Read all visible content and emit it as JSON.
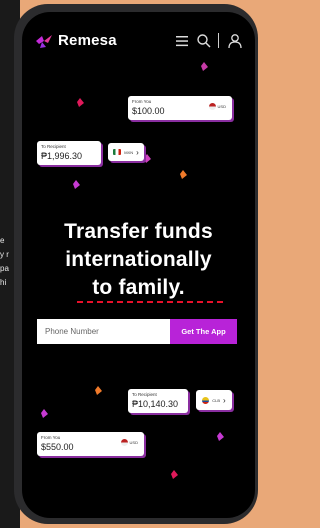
{
  "background_text": [
    "e",
    "y r",
    "pa",
    "hi"
  ],
  "brand": {
    "name": "Remesa",
    "accent": "#b823d8",
    "shadow": "#8a2ea0",
    "underline": "#e8102a"
  },
  "nav": {
    "icons": [
      "menu-icon",
      "search-icon",
      "user-icon"
    ]
  },
  "cards": {
    "top_from": {
      "label": "From You",
      "amount": "$100.00",
      "currency": "USD"
    },
    "top_to": {
      "label": "To Recipient",
      "amount": "₱1,996.30",
      "currency": "MXN"
    },
    "bottom_to": {
      "label": "To Recipient",
      "amount": "₱10,140.30",
      "currency": "CLB"
    },
    "bottom_from": {
      "label": "From You",
      "amount": "$550.00",
      "currency": "USD"
    }
  },
  "hero": {
    "line1": "Transfer funds",
    "line2": "internationally",
    "line3": "to family."
  },
  "signup": {
    "placeholder": "Phone Number",
    "button_label": "Get The App"
  }
}
